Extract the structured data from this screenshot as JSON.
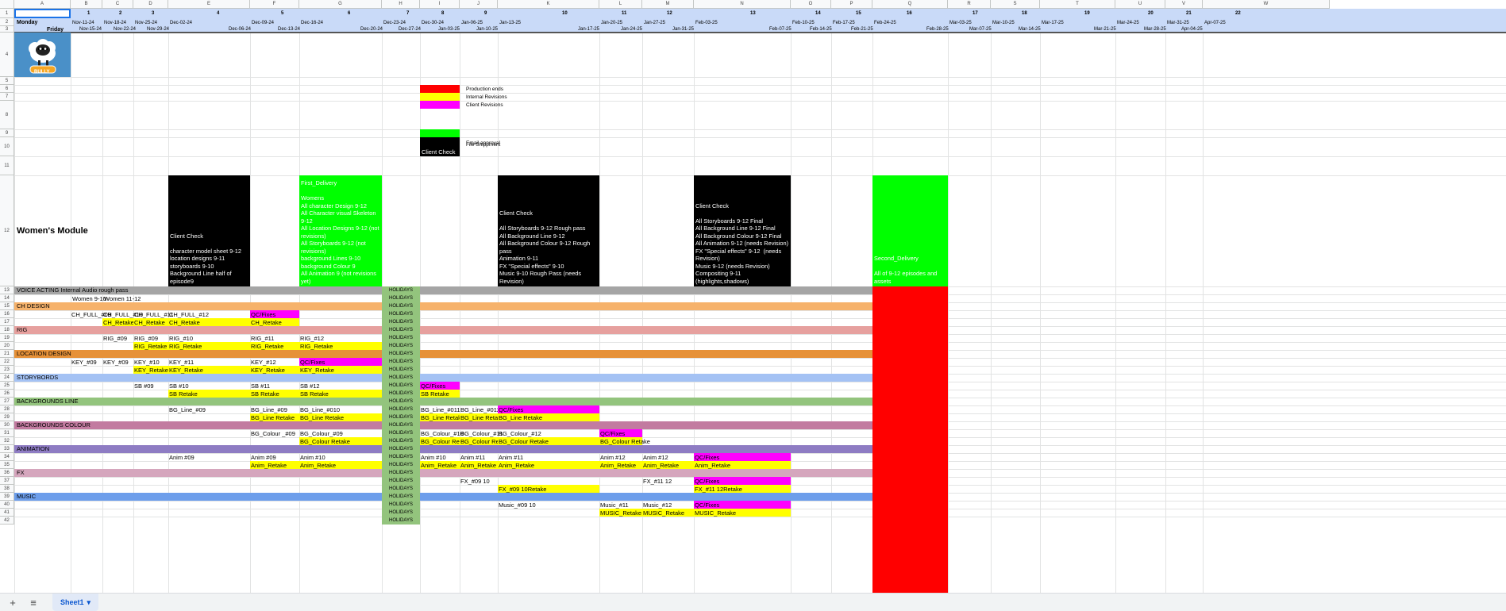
{
  "columns": [
    "A",
    "B",
    "C",
    "D",
    "E",
    "F",
    "G",
    "H",
    "I",
    "J",
    "K",
    "L",
    "M",
    "N",
    "O",
    "P",
    "Q",
    "R",
    "S",
    "T",
    "U",
    "V",
    "W"
  ],
  "rows": [
    "1",
    "2",
    "3",
    "4",
    "5",
    "6",
    "7",
    "8",
    "9",
    "10",
    "11",
    "12",
    "13",
    "14",
    "15",
    "16",
    "17",
    "18",
    "19",
    "20",
    "21",
    "22",
    "23",
    "24",
    "25",
    "26",
    "27",
    "28",
    "29",
    "30",
    "31",
    "32",
    "33",
    "34",
    "35",
    "36",
    "37",
    "38",
    "39",
    "40",
    "41",
    "42"
  ],
  "week_numbers": [
    "1",
    "2",
    "3",
    "",
    "4",
    "5",
    "6",
    "7",
    "8",
    "9",
    "10",
    "11",
    "12",
    "13",
    "14",
    "15",
    "16",
    "17",
    "18",
    "19",
    "20",
    "21",
    "22",
    "23"
  ],
  "row2_dates": [
    "Nov-11-24",
    "Nov-18-24",
    "Nov-25-24",
    "Dec-02-24",
    "Dec-09-24",
    "Dec-16-24",
    "Dec-23-24",
    "Dec-30-24",
    "Jan-06-25",
    "Jan-13-25",
    "Jan-20-25",
    "Jan-27-25",
    "Feb-03-25",
    "Feb-10-25",
    "Feb-17-25",
    "Feb-24-25",
    "Mar-03-25",
    "Mar-10-25",
    "Mar-17-25",
    "Mar-24-25",
    "Mar-31-25",
    "Apr-07-25"
  ],
  "row3_dates": [
    "Nov-15-24",
    "Nov-22-24",
    "Nov-29-24",
    "Dec-06-24",
    "Dec-13-24",
    "Dec-20-24",
    "Dec-27-24",
    "Jan-03-25",
    "Jan-10-25",
    "Jan-17-25",
    "Jan-24-25",
    "Jan-31-25",
    "Feb-07-25",
    "Feb-14-25",
    "Feb-21-25",
    "Feb-28-25",
    "Mar-07-25",
    "Mar-14-25",
    "Mar-21-25",
    "Mar-28-25",
    "Apr-04-25"
  ],
  "labels": {
    "monday": "Monday",
    "friday": "Friday",
    "module_title": "Women's Module",
    "holidays": "HOLIDAYS",
    "women_9_10": "Women 9-10",
    "women_11_12": "Women 11-12"
  },
  "legend": {
    "production_ends": "Production ends",
    "internal_revisions": "Internal Revisions",
    "client_revisions": "Client Revisions",
    "file_shippment": "File Shippment",
    "email_approval": "Email approval",
    "client_check": "Client Check"
  },
  "logo": {
    "text": "BULLY"
  },
  "sections": [
    {
      "label": "VOICE ACTING  Internal Audio rough pass",
      "color": "#a5a5a5"
    },
    {
      "label": "CH DESIGN",
      "color": "#f6b26b"
    },
    {
      "label": "RIG",
      "color": "#e6a09e"
    },
    {
      "label": "LOCATION DESIGN",
      "color": "#e69138"
    },
    {
      "label": "STORYBORDS",
      "color": "#a4c2f4"
    },
    {
      "label": "BACKGROUNDS LINE",
      "color": "#93c47d"
    },
    {
      "label": "BACKGROUNDS COLOUR",
      "color": "#c27ba0"
    },
    {
      "label": "ANIMATION",
      "color": "#8e7cc3"
    },
    {
      "label": "FX",
      "color": "#d5a6bd"
    },
    {
      "label": "MUSIC",
      "color": "#6d9eeb"
    }
  ],
  "milestones": [
    {
      "id": "e",
      "text": "Client Check\n\ncharacter model sheet 9-12\nlocation designs 9-11\nstoryboards 9-10\nBackground Line half of episode9"
    },
    {
      "id": "g",
      "text": "First_Delivery\n\nWomens\nAll character Design 9-12\nAll Character visual Skeleton 9-12\nAll Location Designs 9-12 (not revisions)\nAll Storyboards 9-12 (not revisions)\nbackground Lines 9-10\nbackground Colour 9\nAll Animation 9 (not revisions yet)"
    },
    {
      "id": "k",
      "text": "Client Check\n\nAll Storyboards 9-12 Rough pass\nAll Background Line 9-12\nAll Background Colour 9-12 Rough pass\nAnimation 9-11\nFX \"Special effects\" 9-10\nMusic 9-10 Rough Pass (needs Revision)"
    },
    {
      "id": "n",
      "text": "Client Check\n\nAll Storyboards 9-12 Final\nAll Background Line 9-12 Final\nAll Background Colour 9-12 Final\nAll Animation 9-12 (needs Revision)\nFX \"Special effects\" 9-12  (needs Revision)\nMusic 9-12 (needs Revision)\nCompositing 9-11 (highlights,shadows)"
    },
    {
      "id": "q",
      "text": "Second_Delivery\n\nAll of 9-12 episodes and assets"
    }
  ],
  "cells": [
    {
      "r": 16,
      "c": "B",
      "t": "CH_FULL_#09"
    },
    {
      "r": 16,
      "c": "C",
      "t": "CH_FULL_#10"
    },
    {
      "r": 16,
      "c": "D",
      "t": "CH_FULL_#11"
    },
    {
      "r": 16,
      "c": "E",
      "t": "CH_FULL_#12"
    },
    {
      "r": 16,
      "c": "F",
      "t": "QC/Fixes",
      "bg": "#ff00ff"
    },
    {
      "r": 17,
      "c": "C",
      "t": "CH_Retake",
      "bg": "#ffff00"
    },
    {
      "r": 17,
      "c": "D",
      "t": "CH_Retake",
      "bg": "#ffff00"
    },
    {
      "r": 17,
      "c": "E",
      "t": "CH_Retake",
      "bg": "#ffff00"
    },
    {
      "r": 17,
      "c": "F",
      "t": "CH_Retake",
      "bg": "#ffff00"
    },
    {
      "r": 19,
      "c": "C",
      "t": "RIG_#09"
    },
    {
      "r": 19,
      "c": "D",
      "t": "RIG_#09"
    },
    {
      "r": 19,
      "c": "E",
      "t": "RIG_#10"
    },
    {
      "r": 19,
      "c": "F",
      "t": "RIG_#11"
    },
    {
      "r": 19,
      "c": "G",
      "t": "RIG_#12"
    },
    {
      "r": 20,
      "c": "D",
      "t": "RIG_Retake",
      "bg": "#ffff00"
    },
    {
      "r": 20,
      "c": "E",
      "t": "RIG_Retake",
      "bg": "#ffff00"
    },
    {
      "r": 20,
      "c": "F",
      "t": "RIG_Retake",
      "bg": "#ffff00"
    },
    {
      "r": 20,
      "c": "G",
      "t": "RIG_Retake",
      "bg": "#ffff00"
    },
    {
      "r": 22,
      "c": "B",
      "t": "KEY_#09"
    },
    {
      "r": 22,
      "c": "C",
      "t": "KEY_#09"
    },
    {
      "r": 22,
      "c": "D",
      "t": "KEY_#10"
    },
    {
      "r": 22,
      "c": "E",
      "t": "KEY_#11"
    },
    {
      "r": 22,
      "c": "F",
      "t": "KEY_#12"
    },
    {
      "r": 22,
      "c": "G",
      "t": "QC/Fixes",
      "bg": "#ff00ff"
    },
    {
      "r": 23,
      "c": "D",
      "t": "KEY_Retake",
      "bg": "#ffff00"
    },
    {
      "r": 23,
      "c": "E",
      "t": "KEY_Retake",
      "bg": "#ffff00"
    },
    {
      "r": 23,
      "c": "F",
      "t": "KEY_Retake",
      "bg": "#ffff00"
    },
    {
      "r": 23,
      "c": "G",
      "t": "KEY_Retake",
      "bg": "#ffff00"
    },
    {
      "r": 25,
      "c": "D",
      "t": "SB #09"
    },
    {
      "r": 25,
      "c": "E",
      "t": "SB #10"
    },
    {
      "r": 25,
      "c": "F",
      "t": "SB #11"
    },
    {
      "r": 25,
      "c": "G",
      "t": "SB #12"
    },
    {
      "r": 25,
      "c": "I",
      "t": "QC/Fixes",
      "bg": "#ff00ff"
    },
    {
      "r": 26,
      "c": "E",
      "t": "SB Retake",
      "bg": "#ffff00"
    },
    {
      "r": 26,
      "c": "F",
      "t": "SB Retake",
      "bg": "#ffff00"
    },
    {
      "r": 26,
      "c": "G",
      "t": "SB Retake",
      "bg": "#ffff00"
    },
    {
      "r": 26,
      "c": "I",
      "t": "SB Retake",
      "bg": "#ffff00"
    },
    {
      "r": 28,
      "c": "E",
      "t": "BG_Line_#09"
    },
    {
      "r": 28,
      "c": "F",
      "t": "BG_Line_#09"
    },
    {
      "r": 28,
      "c": "G",
      "t": "BG_Line_#010"
    },
    {
      "r": 28,
      "c": "I",
      "t": "BG_Line_#011"
    },
    {
      "r": 28,
      "c": "J",
      "t": "BG_Line_#012"
    },
    {
      "r": 28,
      "c": "K",
      "t": "QC/Fixes",
      "bg": "#ff00ff"
    },
    {
      "r": 29,
      "c": "F",
      "t": "BG_Line Retake",
      "bg": "#ffff00"
    },
    {
      "r": 29,
      "c": "G",
      "t": "BG_Line Retake",
      "bg": "#ffff00"
    },
    {
      "r": 29,
      "c": "I",
      "t": "BG_Line Retake",
      "bg": "#ffff00"
    },
    {
      "r": 29,
      "c": "J",
      "t": "BG_Line Retake",
      "bg": "#ffff00"
    },
    {
      "r": 29,
      "c": "K",
      "t": "BG_Line Retake",
      "bg": "#ffff00"
    },
    {
      "r": 31,
      "c": "F",
      "t": "BG_Colour _#09"
    },
    {
      "r": 31,
      "c": "G",
      "t": "BG_Colour_#09"
    },
    {
      "r": 31,
      "c": "I",
      "t": "BG_Colour_#10"
    },
    {
      "r": 31,
      "c": "J",
      "t": "BG_Colour_#11"
    },
    {
      "r": 31,
      "c": "K",
      "t": "BG_Colour_#12"
    },
    {
      "r": 31,
      "c": "L",
      "t": "QC/Fixes",
      "bg": "#ff00ff"
    },
    {
      "r": 32,
      "c": "G",
      "t": "BG_Colour Retake",
      "bg": "#ffff00"
    },
    {
      "r": 32,
      "c": "I",
      "t": "BG_Colour Retake",
      "bg": "#ffff00"
    },
    {
      "r": 32,
      "c": "J",
      "t": "BG_Colour Retake",
      "bg": "#ffff00"
    },
    {
      "r": 32,
      "c": "K",
      "t": "BG_Colour Retake",
      "bg": "#ffff00"
    },
    {
      "r": 32,
      "c": "L",
      "t": "BG_Colour Retake",
      "bg": "#ffff00"
    },
    {
      "r": 34,
      "c": "E",
      "t": "Anim #09"
    },
    {
      "r": 34,
      "c": "F",
      "t": "Anim #09"
    },
    {
      "r": 34,
      "c": "G",
      "t": "Anim #10"
    },
    {
      "r": 34,
      "c": "I",
      "t": "Anim #10"
    },
    {
      "r": 34,
      "c": "J",
      "t": "Anim #11"
    },
    {
      "r": 34,
      "c": "K",
      "t": "Anim #11"
    },
    {
      "r": 34,
      "c": "L",
      "t": "Anim #12"
    },
    {
      "r": 34,
      "c": "M",
      "t": "Anim #12"
    },
    {
      "r": 34,
      "c": "N",
      "t": "QC/Fixes",
      "bg": "#ff00ff"
    },
    {
      "r": 35,
      "c": "F",
      "t": "Anim_Retake",
      "bg": "#ffff00"
    },
    {
      "r": 35,
      "c": "G",
      "t": "Anim_Retake",
      "bg": "#ffff00"
    },
    {
      "r": 35,
      "c": "I",
      "t": "Anim_Retake",
      "bg": "#ffff00"
    },
    {
      "r": 35,
      "c": "J",
      "t": "Anim_Retake",
      "bg": "#ffff00"
    },
    {
      "r": 35,
      "c": "K",
      "t": "Anim_Retake",
      "bg": "#ffff00"
    },
    {
      "r": 35,
      "c": "L",
      "t": "Anim_Retake",
      "bg": "#ffff00"
    },
    {
      "r": 35,
      "c": "M",
      "t": "Anim_Retake",
      "bg": "#ffff00"
    },
    {
      "r": 35,
      "c": "N",
      "t": "Anim_Retake",
      "bg": "#ffff00"
    },
    {
      "r": 37,
      "c": "J",
      "t": "FX_#09 10"
    },
    {
      "r": 37,
      "c": "M",
      "t": "FX_#11 12"
    },
    {
      "r": 37,
      "c": "N",
      "t": "QC/Fixes",
      "bg": "#ff00ff"
    },
    {
      "r": 38,
      "c": "K",
      "t": "FX_#09 10Retake",
      "bg": "#ffff00"
    },
    {
      "r": 38,
      "c": "N",
      "t": "FX_#11 12Retake",
      "bg": "#ffff00"
    },
    {
      "r": 40,
      "c": "K",
      "t": "Music_#09 10"
    },
    {
      "r": 40,
      "c": "L",
      "t": "Music_#11"
    },
    {
      "r": 40,
      "c": "M",
      "t": "Music_#12"
    },
    {
      "r": 40,
      "c": "N",
      "t": "QC/Fixes",
      "bg": "#ff00ff"
    },
    {
      "r": 41,
      "c": "L",
      "t": "MUSIC_Retake",
      "bg": "#ffff00"
    },
    {
      "r": 41,
      "c": "M",
      "t": "MUSIC_Retake",
      "bg": "#ffff00"
    },
    {
      "r": 41,
      "c": "N",
      "t": "MUSIC_Retake",
      "bg": "#ffff00"
    }
  ],
  "tabbar": {
    "add": "+",
    "menu": "≡",
    "sheet_name": "Sheet1",
    "sheet_caret": "▾"
  }
}
